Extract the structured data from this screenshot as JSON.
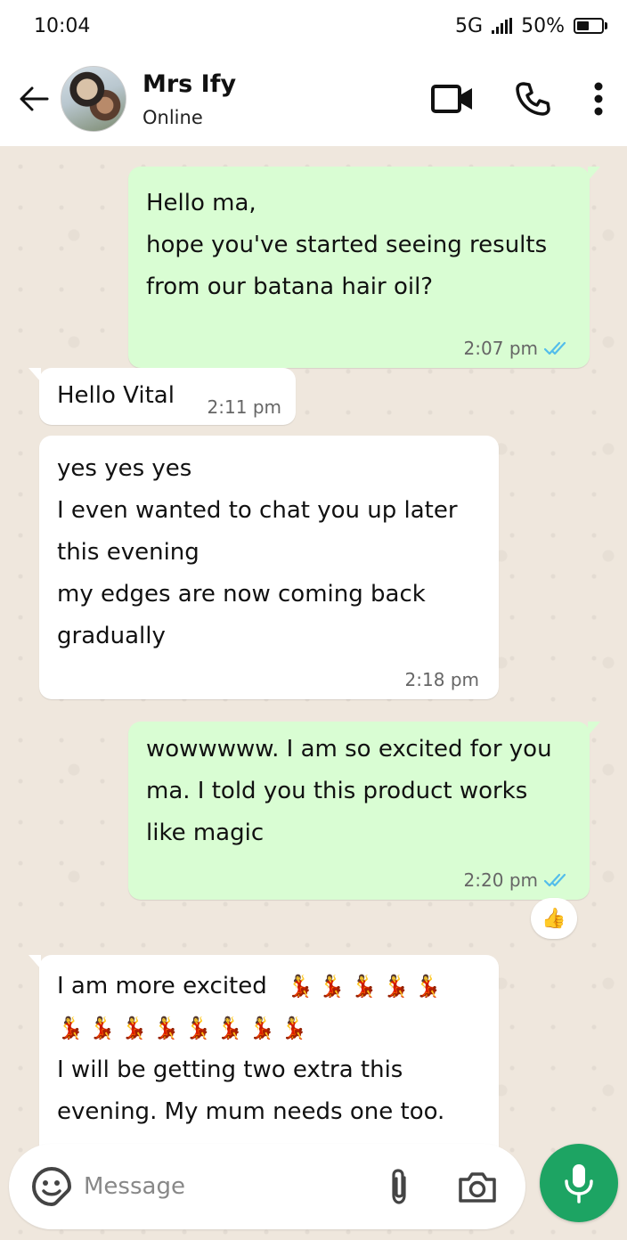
{
  "status_bar": {
    "time": "10:04",
    "network": "5G",
    "battery": "50%",
    "battery_level": 0.5
  },
  "header": {
    "contact_name": "Mrs Ify",
    "contact_status": "Online",
    "icons": [
      "back-arrow-icon",
      "video-call-icon",
      "phone-call-icon",
      "more-options-icon"
    ]
  },
  "messages": [
    {
      "direction": "outgoing",
      "text": "Hello ma,\nhope you've started seeing results\nfrom our batana hair oil?",
      "time": "2:07 pm",
      "status": "read"
    },
    {
      "direction": "incoming",
      "text": "Hello Vital",
      "time": "2:11 pm"
    },
    {
      "direction": "incoming",
      "text": "yes yes yes\nI even wanted to chat you up later\nthis evening\nmy edges are now coming back\ngradually",
      "time": "2:18 pm"
    },
    {
      "direction": "outgoing",
      "text": "wowwwww. I am so excited for you\nma. I told you this product works\nlike magic",
      "time": "2:20 pm",
      "status": "read",
      "reaction": "👍"
    },
    {
      "direction": "incoming",
      "line1": "I am more excited",
      "emojis_line1": "💃💃💃💃💃",
      "emojis_line2": "💃💃💃💃💃💃💃💃",
      "text": "I will be getting two extra this\nevening. My mum needs one too."
    }
  ],
  "composer": {
    "placeholder": "Message",
    "icons": [
      "sticker-icon",
      "attach-icon",
      "camera-icon",
      "microphone-icon"
    ]
  },
  "colors": {
    "outgoing_bubble": "#d9fdd3",
    "incoming_bubble": "#ffffff",
    "chat_background": "#efe7dd",
    "read_ticks": "#53bdeb",
    "mic_button": "#1da463"
  }
}
